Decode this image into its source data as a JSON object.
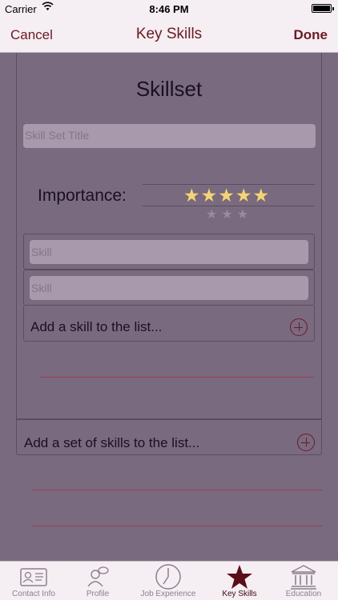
{
  "status": {
    "carrier": "Carrier",
    "time": "8:46 PM"
  },
  "nav": {
    "cancel": "Cancel",
    "title": "Key Skills",
    "done": "Done"
  },
  "skillset": {
    "title": "Skillset",
    "title_placeholder": "Skill Set Title",
    "importance_label": "Importance:",
    "rating": 5,
    "rating_max": 5,
    "skills": [
      {
        "placeholder": "Skill"
      },
      {
        "placeholder": "Skill"
      }
    ],
    "add_skill_label": "Add a skill to the list..."
  },
  "add_set_label": "Add a set of skills to the list...",
  "tabs": [
    {
      "label": "Contact Info",
      "icon": "contact-card-icon",
      "active": false
    },
    {
      "label": "Profile",
      "icon": "profile-icon",
      "active": false
    },
    {
      "label": "Job Experience",
      "icon": "clock-icon",
      "active": false
    },
    {
      "label": "Key Skills",
      "icon": "star-icon",
      "active": true
    },
    {
      "label": "Education",
      "icon": "institution-icon",
      "active": false
    }
  ],
  "colors": {
    "accent": "#6b1a24",
    "background": "#7a6a80",
    "bar": "#f5eef2"
  }
}
